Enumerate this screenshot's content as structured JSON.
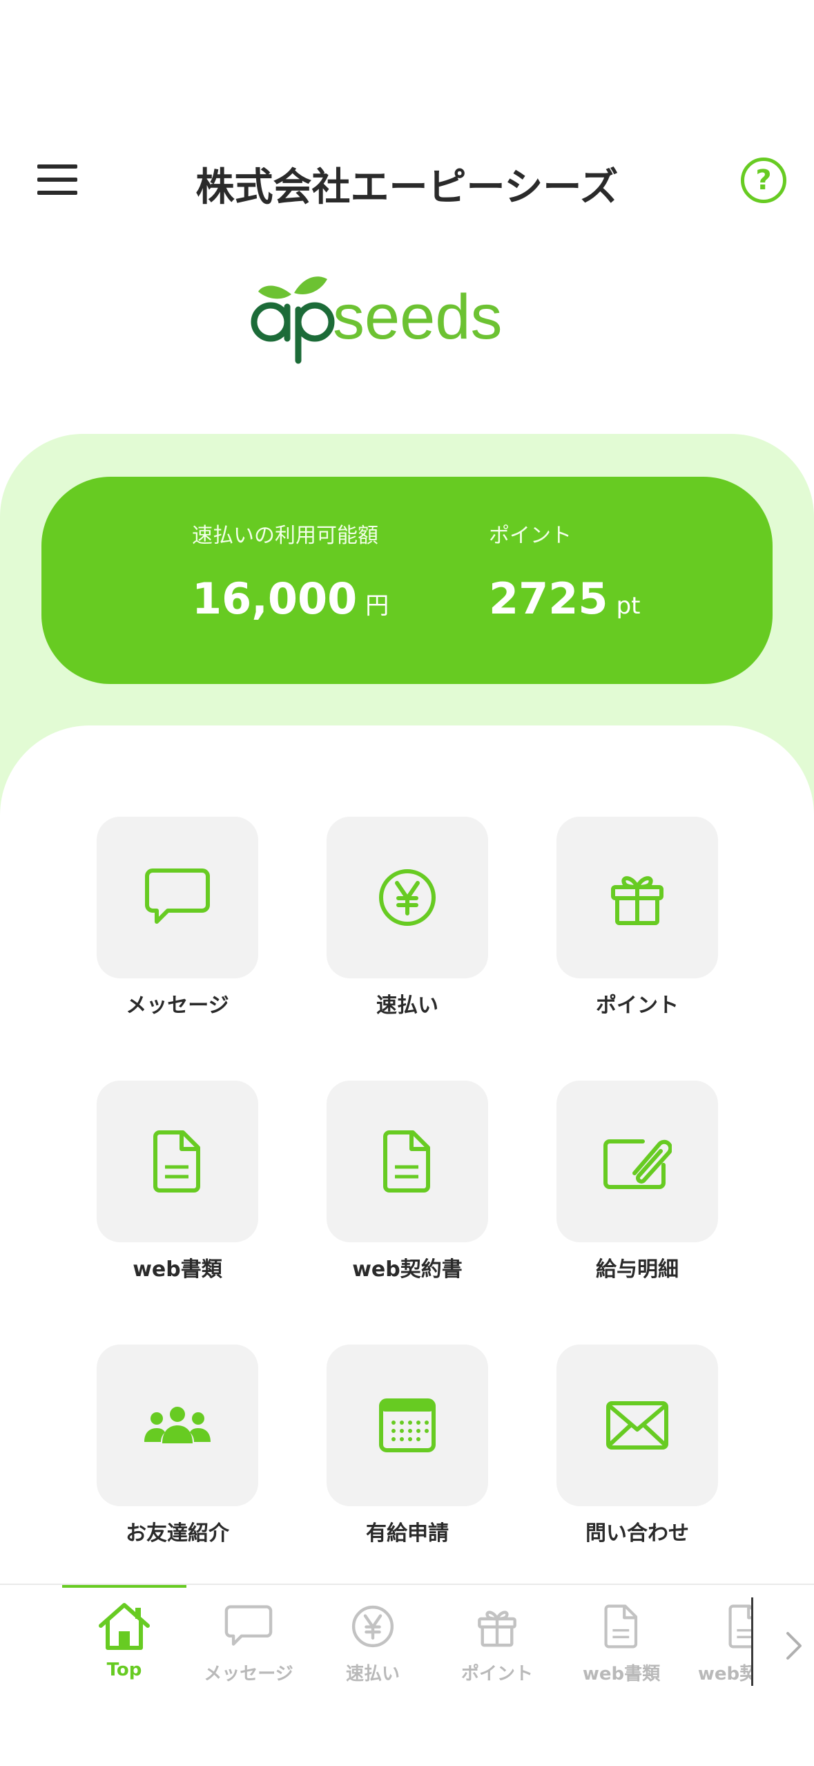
{
  "header": {
    "title": "株式会社エーピーシーズ",
    "help_label": "?"
  },
  "logo": {
    "text_ap": "ap",
    "text_seeds": "seeds"
  },
  "balance": {
    "payout_label": "速払いの利用可能額",
    "payout_value": "16,000",
    "payout_unit": "円",
    "points_label": "ポイント",
    "points_value": "2725",
    "points_unit": "pt"
  },
  "menu": {
    "items": [
      {
        "label": "メッセージ",
        "icon": "message-icon"
      },
      {
        "label": "速払い",
        "icon": "yen-icon"
      },
      {
        "label": "ポイント",
        "icon": "gift-icon"
      },
      {
        "label": "web書類",
        "icon": "document-icon"
      },
      {
        "label": "web契約書",
        "icon": "document-icon"
      },
      {
        "label": "給与明細",
        "icon": "payslip-clip-icon"
      },
      {
        "label": "お友達紹介",
        "icon": "people-icon"
      },
      {
        "label": "有給申請",
        "icon": "calendar-icon"
      },
      {
        "label": "問い合わせ",
        "icon": "mail-icon"
      }
    ]
  },
  "bottom_nav": {
    "items": [
      {
        "label": "Top",
        "icon": "home-icon",
        "active": true
      },
      {
        "label": "メッセージ",
        "icon": "message-icon"
      },
      {
        "label": "速払い",
        "icon": "yen-icon"
      },
      {
        "label": "ポイント",
        "icon": "gift-icon"
      },
      {
        "label": "web書類",
        "icon": "document-icon"
      },
      {
        "label": "web契約書",
        "icon": "document-icon"
      }
    ]
  },
  "colors": {
    "brand_green": "#67cb22",
    "light_green_bg": "#e2fbd4",
    "tile_bg": "#f2f2f2",
    "inactive_gray": "#b9b9b9"
  }
}
